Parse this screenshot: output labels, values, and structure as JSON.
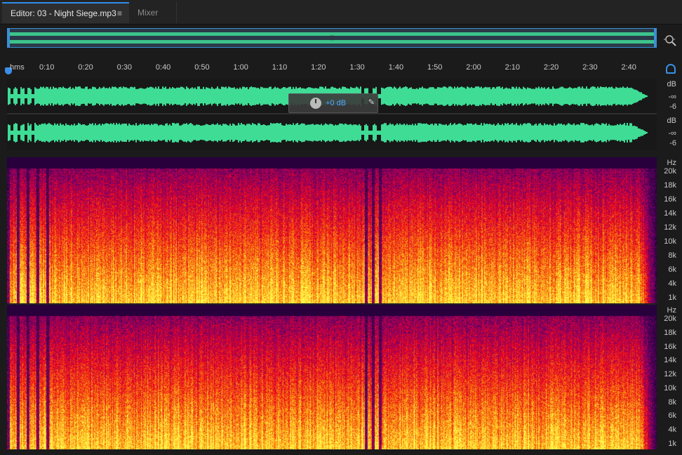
{
  "tabs": {
    "editor_label": "Editor: 03 - Night Siege.mp3",
    "mixer_label": "Mixer"
  },
  "timeline": {
    "unit_label": "hms",
    "ticks": [
      "0:10",
      "0:20",
      "0:30",
      "0:40",
      "0:50",
      "1:00",
      "1:10",
      "1:20",
      "1:30",
      "1:40",
      "1:50",
      "2:00",
      "2:10",
      "2:20",
      "2:30",
      "2:40"
    ]
  },
  "hud": {
    "volume_label": "+0 dB"
  },
  "waveform_ruler": {
    "unit": "dB",
    "labels": [
      "-∞",
      "-6"
    ]
  },
  "spectral_ruler": {
    "unit": "Hz",
    "labels": [
      "20k",
      "18k",
      "16k",
      "14k",
      "12k",
      "10k",
      "8k",
      "6k",
      "4k",
      "1k"
    ]
  },
  "colors": {
    "accent": "#2d8ceb",
    "waveform": "#3fdc96"
  },
  "icons": {
    "zoom": "magnify-zoom-icon",
    "headphones": "headphones-icon",
    "pin": "pin-icon",
    "menu": "hamburger-menu-icon"
  }
}
